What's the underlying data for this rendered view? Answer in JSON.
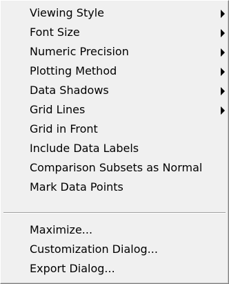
{
  "menu": {
    "items": [
      {
        "label": "Viewing Style",
        "submenu": true
      },
      {
        "label": "Font Size",
        "submenu": true
      },
      {
        "label": "Numeric Precision",
        "submenu": true
      },
      {
        "label": "Plotting Method",
        "submenu": true
      },
      {
        "label": "Data Shadows",
        "submenu": true
      },
      {
        "label": "Grid Lines",
        "submenu": true
      },
      {
        "label": "Grid in Front",
        "submenu": false
      },
      {
        "label": "Include Data Labels",
        "submenu": false
      },
      {
        "label": "Comparison Subsets as Normal",
        "submenu": false
      },
      {
        "label": "Mark Data Points",
        "submenu": false
      }
    ],
    "bottom_items": [
      {
        "label": "Maximize..."
      },
      {
        "label": "Customization Dialog..."
      },
      {
        "label": "Export Dialog..."
      }
    ]
  },
  "icons": {
    "submenu_arrow": "chevron-right-icon"
  },
  "colors": {
    "menu_background": "#f0f0f0",
    "text": "#000000",
    "separator_dark": "#a0a0a0",
    "separator_light": "#ffffff"
  }
}
